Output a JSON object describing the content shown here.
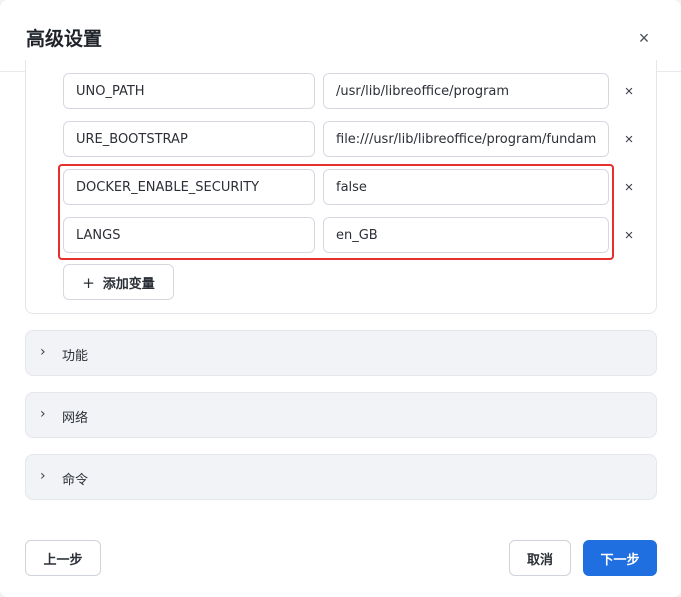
{
  "dialog": {
    "title": "高级设置",
    "close_icon": "×"
  },
  "env_vars": [
    {
      "key": "UNO_PATH",
      "value": "/usr/lib/libreoffice/program"
    },
    {
      "key": "URE_BOOTSTRAP",
      "value": "file:///usr/lib/libreoffice/program/fundamentalrc"
    },
    {
      "key": "DOCKER_ENABLE_SECURITY",
      "value": "false"
    },
    {
      "key": "LANGS",
      "value": "en_GB"
    }
  ],
  "remove_icon": "×",
  "add_variable": {
    "icon": "+",
    "label": "添加变量"
  },
  "sections": [
    {
      "label": "功能",
      "icon": "chevron-right-icon"
    },
    {
      "label": "网络",
      "icon": "chevron-right-icon"
    },
    {
      "label": "命令",
      "icon": "chevron-right-icon"
    }
  ],
  "chevron_glyph": "›",
  "footer": {
    "prev_label": "上一步",
    "cancel_label": "取消",
    "next_label": "下一步"
  },
  "colors": {
    "highlight": "#e5302b",
    "primary": "#1f6fe0"
  }
}
